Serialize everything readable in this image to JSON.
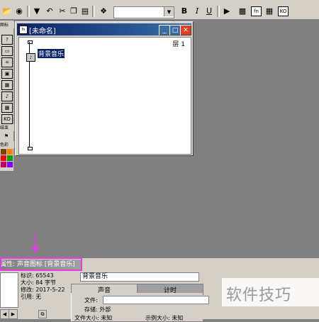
{
  "toolbar": {
    "icons": [
      "open-icon",
      "save-icon",
      "undo-icon",
      "cut-icon",
      "copy-icon",
      "paste-icon",
      "find-icon",
      "font-select",
      "bold",
      "italic",
      "underline",
      "run-icon",
      "control-panel-icon",
      "variables-icon",
      "functions-icon",
      "knowledge-icon"
    ],
    "bold": "B",
    "italic": "I",
    "underline": "U"
  },
  "palette": {
    "header": "图标",
    "end_label": "结束",
    "color_label": "色彩",
    "colors": [
      "#000000",
      "#ff0000",
      "#0000ff",
      "#ffff00",
      "#00ff00",
      "#ff00ff",
      "#008080",
      "#800080",
      "#008000",
      "#c0c0c0"
    ]
  },
  "window": {
    "title": "[未命名]",
    "layer": "层 1",
    "icon_label": "背景音乐"
  },
  "annotation": {
    "color": "#e040e0"
  },
  "properties": {
    "title": "属性: 声音图标 [背景音乐]",
    "id": "标识: 65543",
    "size": "大小: 84 字节",
    "modified": "修改: 2017-5-22",
    "reference": "引用: 无",
    "name": "背景音乐",
    "tabs": [
      "声音",
      "计时"
    ],
    "file_label": "文件:",
    "storage": "存储: 外部",
    "file_size": "文件大小: 未知",
    "sample_size": "示例大小: 未知"
  },
  "watermark": "软件技巧"
}
